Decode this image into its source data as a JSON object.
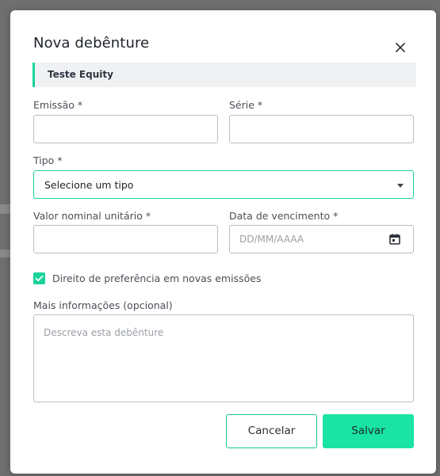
{
  "modal": {
    "title": "Nova debênture",
    "company": "Teste Equity"
  },
  "form": {
    "emissao": {
      "label": "Emissão *",
      "value": ""
    },
    "serie": {
      "label": "Série *",
      "value": ""
    },
    "tipo": {
      "label": "Tipo *",
      "selected": "Selecione um tipo"
    },
    "valor_nominal": {
      "label": "Valor nominal unitário *",
      "value": ""
    },
    "data_vencimento": {
      "label": "Data de vencimento *",
      "placeholder": "DD/MM/AAAA"
    },
    "preferencia": {
      "label": "Direito de preferência em novas emissões",
      "checked": true
    },
    "mais_info": {
      "label": "Mais informações (opcional)",
      "placeholder": "Descreva esta debênture"
    }
  },
  "actions": {
    "cancel_label": "Cancelar",
    "save_label": "Salvar"
  },
  "icons": {
    "close": "close-icon",
    "caret": "chevron-down-icon",
    "calendar": "calendar-icon",
    "check": "check-icon"
  },
  "colors": {
    "accent": "#19d39a",
    "save_button": "#19e4a4",
    "banner_bg": "#f0f1f3",
    "backdrop": "#6f6f6f"
  }
}
